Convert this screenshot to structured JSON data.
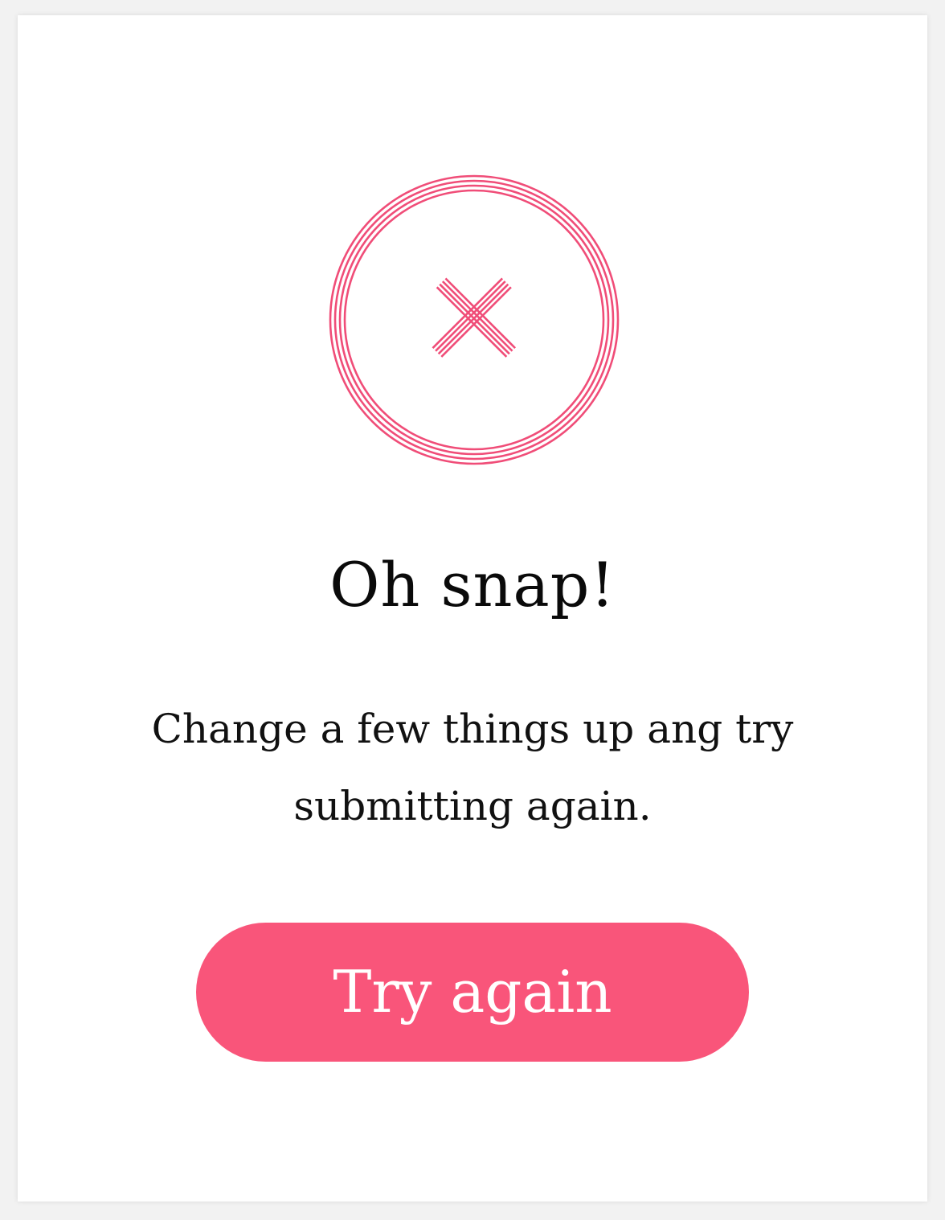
{
  "dialog": {
    "title": "Oh snap!",
    "message": "Change a few things up ang try submitting again.",
    "button_label": "Try again",
    "icon": "close-icon"
  },
  "colors": {
    "accent": "#f9557a",
    "ring": "#f04d78",
    "text": "#0a0a0a",
    "background": "#ffffff"
  }
}
